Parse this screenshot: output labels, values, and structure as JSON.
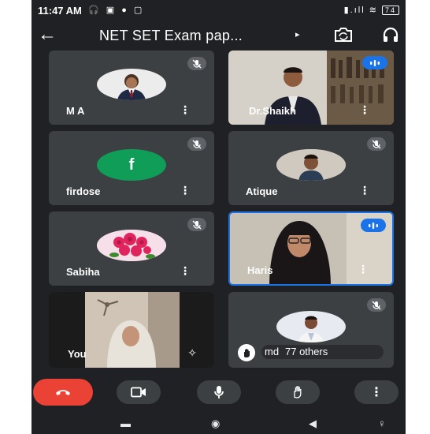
{
  "status_bar": {
    "time": "11:47 AM",
    "battery": "74"
  },
  "meeting": {
    "title": "NET SET Exam pap..."
  },
  "participants": [
    {
      "name": "M A",
      "state": "muted"
    },
    {
      "name": "Dr.Shaikh",
      "state": "speaking"
    },
    {
      "name": "firdose",
      "initial": "f",
      "avatar_color": "#0f9d58",
      "state": "muted"
    },
    {
      "name": "Atique",
      "state": "muted"
    },
    {
      "name": "Sabiha",
      "state": "muted"
    },
    {
      "name": "Haris",
      "state": "speaking"
    },
    {
      "name": "You"
    }
  ],
  "others_tile": {
    "prefix": "md",
    "others_label": "77 others"
  },
  "colors": {
    "end_call": "#ea4335",
    "speaking": "#1a73e8",
    "tile": "#3c4043",
    "background": "#202124"
  }
}
